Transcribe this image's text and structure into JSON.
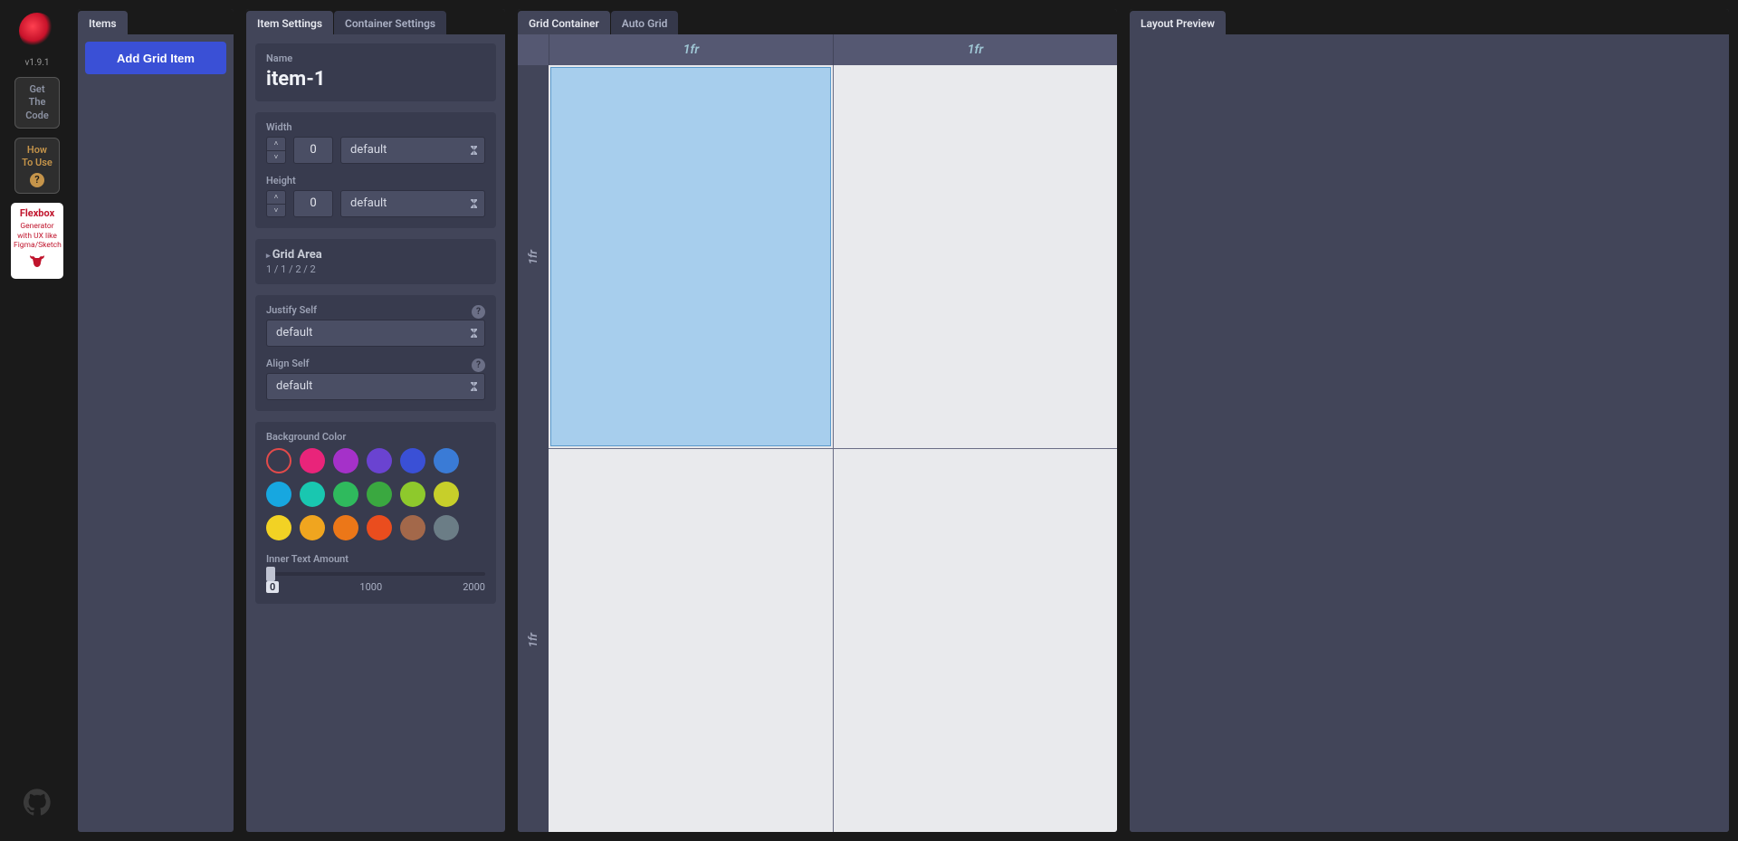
{
  "version": "v1.9.1",
  "rail": {
    "get_code": "Get\nThe\nCode",
    "how": "How\nTo Use",
    "flex_title": "Flexbox",
    "flex_sub": "Generator with UX like Figma/Sketch"
  },
  "items_panel": {
    "tab": "Items",
    "add_label": "Add Grid Item"
  },
  "settings_panel": {
    "tabs": [
      "Item Settings",
      "Container Settings"
    ],
    "active_tab": 0,
    "name_label": "Name",
    "name_value": "item-1",
    "width_label": "Width",
    "width_value": "0",
    "width_unit": "default",
    "height_label": "Height",
    "height_value": "0",
    "height_unit": "default",
    "grid_area_label": "Grid Area",
    "grid_area_value": "1 / 1 / 2 / 2",
    "justify_label": "Justify Self",
    "justify_value": "default",
    "align_label": "Align Self",
    "align_value": "default",
    "bgc_label": "Background Color",
    "colors": [
      "transparent",
      "#e9247a",
      "#a531c9",
      "#6a43d1",
      "#3a50d6",
      "#3a7bd6",
      "#17a7e0",
      "#19c7b0",
      "#2fba5d",
      "#3aa840",
      "#8ec92c",
      "#c7cf2a",
      "#f2d224",
      "#f0a51f",
      "#ec7718",
      "#ea4d1e",
      "#a3684a",
      "#6b7d86"
    ],
    "selected_color_index": 0,
    "inner_text_label": "Inner Text Amount",
    "slider": {
      "min": 0,
      "mid": 1000,
      "max": 2000,
      "value": 0
    }
  },
  "grid_panel": {
    "tabs": [
      "Grid Container",
      "Auto Grid"
    ],
    "active_tab": 0,
    "cols": [
      "1fr",
      "1fr"
    ],
    "rows": [
      "1fr",
      "1fr"
    ],
    "item_cell": 0
  },
  "preview_panel": {
    "tab": "Layout Preview"
  }
}
